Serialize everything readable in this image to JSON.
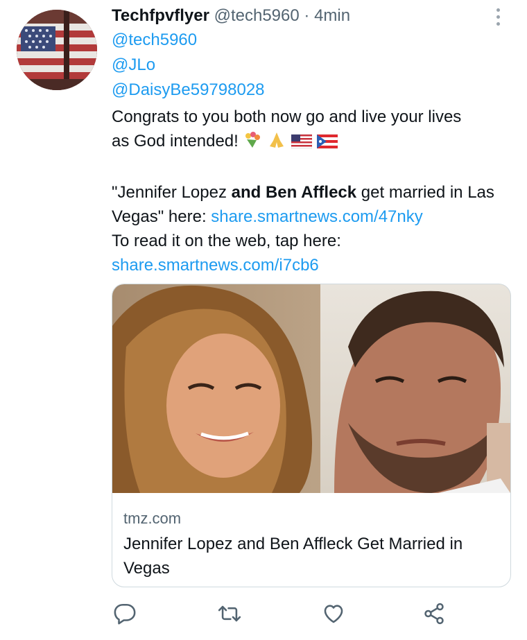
{
  "tweet": {
    "author_name": "Techfpvflyer",
    "author_handle": "@tech5960",
    "separator": "·",
    "time": "4min",
    "mentions": [
      "@tech5960",
      "@JLo",
      "@DaisyBe59798028"
    ],
    "line1": "Congrats to you both now go and live your lives",
    "line2": "as God intended!",
    "emojis": [
      "bouquet-emoji",
      "praying-hands-emoji",
      "us-flag-emoji",
      "puerto-rico-flag-emoji"
    ],
    "quote_open": "\"Jennifer Lopez ",
    "quote_bold": "and Ben Affleck",
    "quote_rest": " get married in Las Vegas\" here: ",
    "link1": "share.smartnews.com/47nky",
    "read_text": "To read it on the web, tap here:",
    "link2": "share.smartnews.com/i7cb6"
  },
  "card": {
    "domain": "tmz.com",
    "title": "Jennifer Lopez and Ben Affleck Get Married in Vegas",
    "image_icon": "couple-photo"
  },
  "actions": {
    "reply_icon": "reply-icon",
    "retweet_icon": "retweet-icon",
    "like_icon": "heart-icon",
    "share_icon": "share-icon"
  },
  "colors": {
    "accent": "#1d9bf0",
    "secondary_text": "#536471",
    "primary_text": "#0f1419",
    "border": "#cfd9de"
  }
}
